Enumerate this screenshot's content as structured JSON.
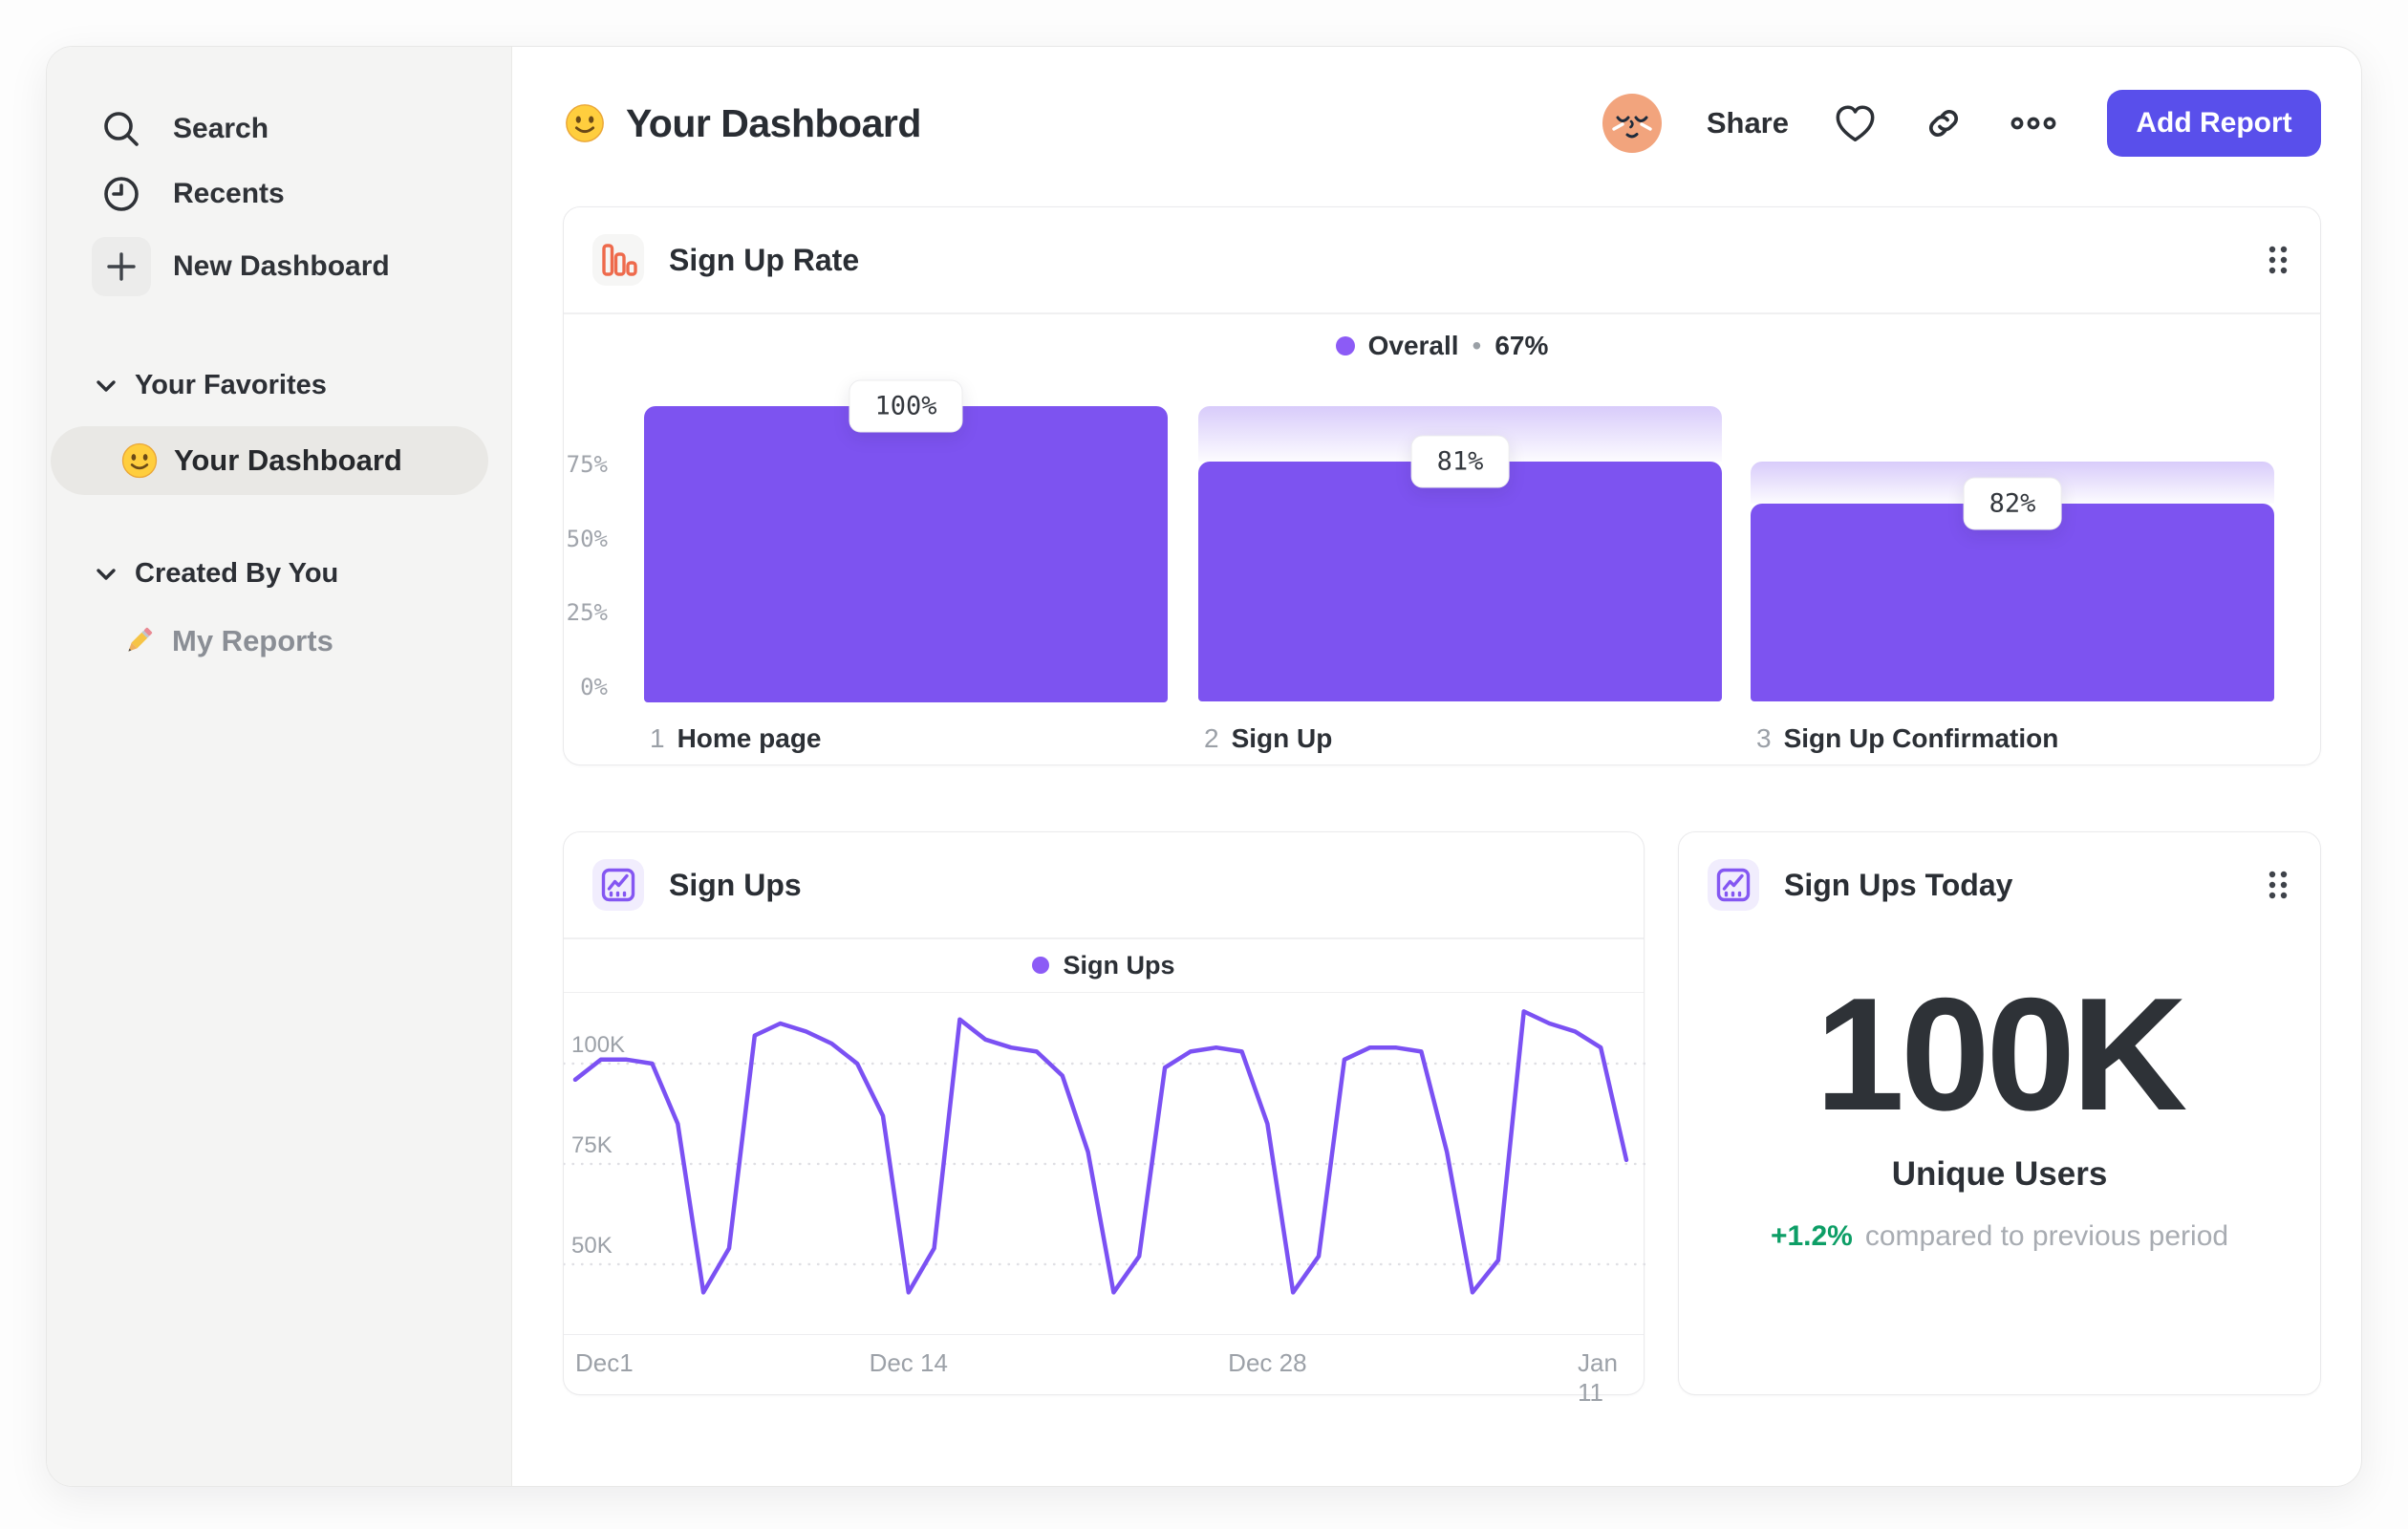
{
  "sidebar": {
    "nav": [
      {
        "label": "Search",
        "icon": "search-icon"
      },
      {
        "label": "Recents",
        "icon": "clock-icon"
      },
      {
        "label": "New Dashboard",
        "icon": "plus-icon"
      }
    ],
    "sections": [
      {
        "title": "Your Favorites",
        "items": [
          {
            "label": "Your Dashboard",
            "icon": "smiley-face-emoji",
            "selected": true
          }
        ]
      },
      {
        "title": "Created By You",
        "items": [
          {
            "label": "My Reports",
            "icon": "pencil-emoji",
            "selected": false
          }
        ]
      }
    ]
  },
  "header": {
    "emoji_icon": "smiley-face-emoji",
    "title": "Your Dashboard",
    "share_label": "Share",
    "add_report_label": "Add Report",
    "accent_color": "#594feb",
    "icons": [
      "avatar",
      "heart-icon",
      "link-icon",
      "ellipsis-icon"
    ]
  },
  "funnel_card": {
    "icon": "bar-chart-icon",
    "icon_color": "#ee6a4c",
    "title": "Sign Up Rate",
    "legend_label": "Overall",
    "legend_separator": "•",
    "legend_value": "67%",
    "legend_dot_color": "#8c5bf6"
  },
  "line_card": {
    "icon": "line-chart-icon",
    "icon_color": "#8457f2",
    "title": "Sign Ups",
    "legend_label": "Sign Ups",
    "legend_dot_color": "#8c5bf6"
  },
  "kpi_card": {
    "icon": "line-chart-icon",
    "title": "Sign Ups Today",
    "value": "100K",
    "label": "Unique Users",
    "delta": "+1.2%",
    "delta_color": "#0d9e66",
    "delta_note": "compared to previous period"
  },
  "chart_data": [
    {
      "type": "bar",
      "subtype": "funnel",
      "title": "Sign Up Rate",
      "overall_conversion": "67%",
      "categories": [
        "Home page",
        "Sign Up",
        "Sign Up Confirmation"
      ],
      "step_numbers": [
        "1",
        "2",
        "3"
      ],
      "step_conversion_labels": [
        "100%",
        "81%",
        "82%"
      ],
      "overall_pct": [
        100,
        81,
        67
      ],
      "bar_color": "#7d53f0",
      "yticks": [
        {
          "label": "75%",
          "value": 75
        },
        {
          "label": "50%",
          "value": 50
        },
        {
          "label": "25%",
          "value": 25
        },
        {
          "label": "0%",
          "value": 0
        }
      ],
      "ylim": [
        0,
        100
      ],
      "grid": false,
      "legend_position": "top-center"
    },
    {
      "type": "line",
      "title": "Sign Ups",
      "series": [
        {
          "name": "Sign Ups",
          "color": "#7b51f3",
          "values_k": [
            96,
            101,
            101,
            100,
            85,
            43,
            54,
            107,
            110,
            108,
            105,
            100,
            87,
            43,
            54,
            111,
            106,
            104,
            103,
            97,
            78,
            43,
            52,
            99,
            103,
            104,
            103,
            85,
            43,
            52,
            101,
            104,
            104,
            103,
            78,
            43,
            51,
            113,
            110,
            108,
            104,
            76
          ]
        }
      ],
      "xticks": [
        {
          "label": "Dec1",
          "index": 0
        },
        {
          "label": "Dec 14",
          "index": 13
        },
        {
          "label": "Dec 28",
          "index": 27
        },
        {
          "label": "Jan 11",
          "index": 41
        }
      ],
      "yticks": [
        {
          "label": "100K",
          "value": 100
        },
        {
          "label": "75K",
          "value": 75
        },
        {
          "label": "50K",
          "value": 50
        }
      ],
      "ylim_k": [
        32,
        118
      ],
      "unit": "K",
      "grid": "dashed-horizontal",
      "legend_position": "top-center"
    }
  ]
}
